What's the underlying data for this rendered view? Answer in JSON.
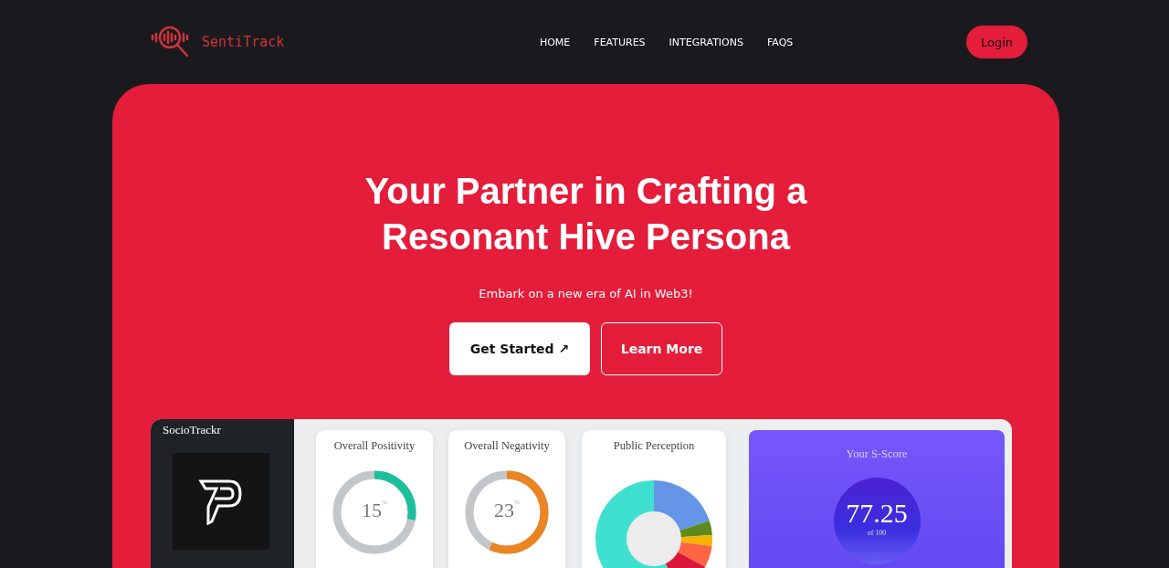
{
  "header": {
    "brand": "SentiTrack",
    "nav": [
      {
        "label": "HOME"
      },
      {
        "label": "FEATURES"
      },
      {
        "label": "INTEGRATIONS"
      },
      {
        "label": "FAQS"
      }
    ],
    "login": "Login"
  },
  "hero": {
    "title_lines": [
      "Your Partner in Crafting a",
      "Resonant Hive Persona"
    ],
    "subtitle": "Embark on a new era of AI in Web3!",
    "primary_button": "Get Started ↗",
    "secondary_button": "Learn More"
  },
  "dashboard": {
    "app_name": "SocioTrackr",
    "gauges": [
      {
        "title": "Overall Positivity",
        "value": "15",
        "unit": "%",
        "level": 0.28,
        "color": "#1bbf9a"
      },
      {
        "title": "Overall Negativity",
        "value": "23",
        "unit": "%",
        "level": 0.57,
        "color": "#ea8522"
      }
    ],
    "perception": {
      "title": "Public Perception"
    },
    "score": {
      "title": "Your S-Score",
      "value": "77.25",
      "caption": "of 100"
    }
  }
}
